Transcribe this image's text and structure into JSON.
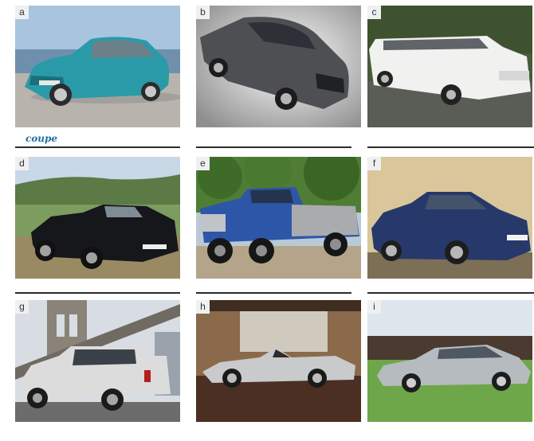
{
  "exercise": {
    "cards": [
      {
        "letter": "a",
        "answer": "coupe",
        "image": "teal convertible coupe, roof up"
      },
      {
        "letter": "b",
        "answer": "",
        "image": "dark grey estate car"
      },
      {
        "letter": "c",
        "answer": "",
        "image": "white stretch limousine"
      },
      {
        "letter": "d",
        "answer": "",
        "image": "black open convertible"
      },
      {
        "letter": "e",
        "answer": "",
        "image": "blue and silver pick-up truck"
      },
      {
        "letter": "f",
        "answer": "",
        "image": "blue hatchback"
      },
      {
        "letter": "g",
        "answer": "",
        "image": "silver 4x4 / SUV"
      },
      {
        "letter": "h",
        "answer": "",
        "image": "silver roadster sports car"
      },
      {
        "letter": "i",
        "answer": "",
        "image": "silver saloon"
      }
    ],
    "colors": {
      "answer_text": "#1f6fa6",
      "rule": "#2b2b2b"
    }
  }
}
